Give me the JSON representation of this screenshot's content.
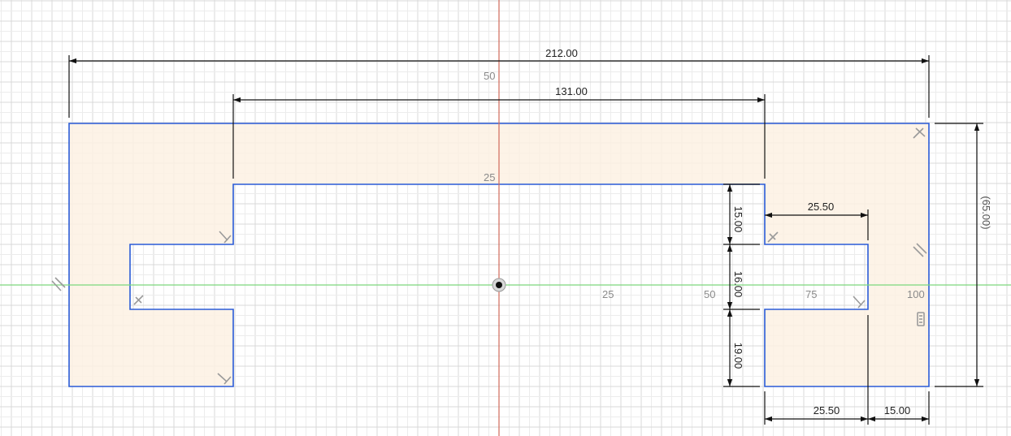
{
  "sketch": {
    "dimensions": {
      "overall_width": "212.00",
      "inner_width": "131.00",
      "right_notch_width": "25.50",
      "upper_step": "15.00",
      "notch_height": "16.00",
      "lower_step": "19.00",
      "bottom_notch_width": "25.50",
      "right_wall": "15.00",
      "overall_height": "(65.00)"
    },
    "axis_labels": {
      "y_50": "50",
      "y_25": "25",
      "x_25": "25",
      "x_50": "50",
      "x_75": "75",
      "x_100": "100"
    },
    "colors": {
      "profile_line": "#2a5bd7",
      "profile_fill": "#fdf1e3",
      "x_axis": "#7dd87d",
      "y_axis": "#d06a5a",
      "dimension": "#111111",
      "grid_minor": "#ececec",
      "grid_major": "#d9d9d9"
    }
  }
}
